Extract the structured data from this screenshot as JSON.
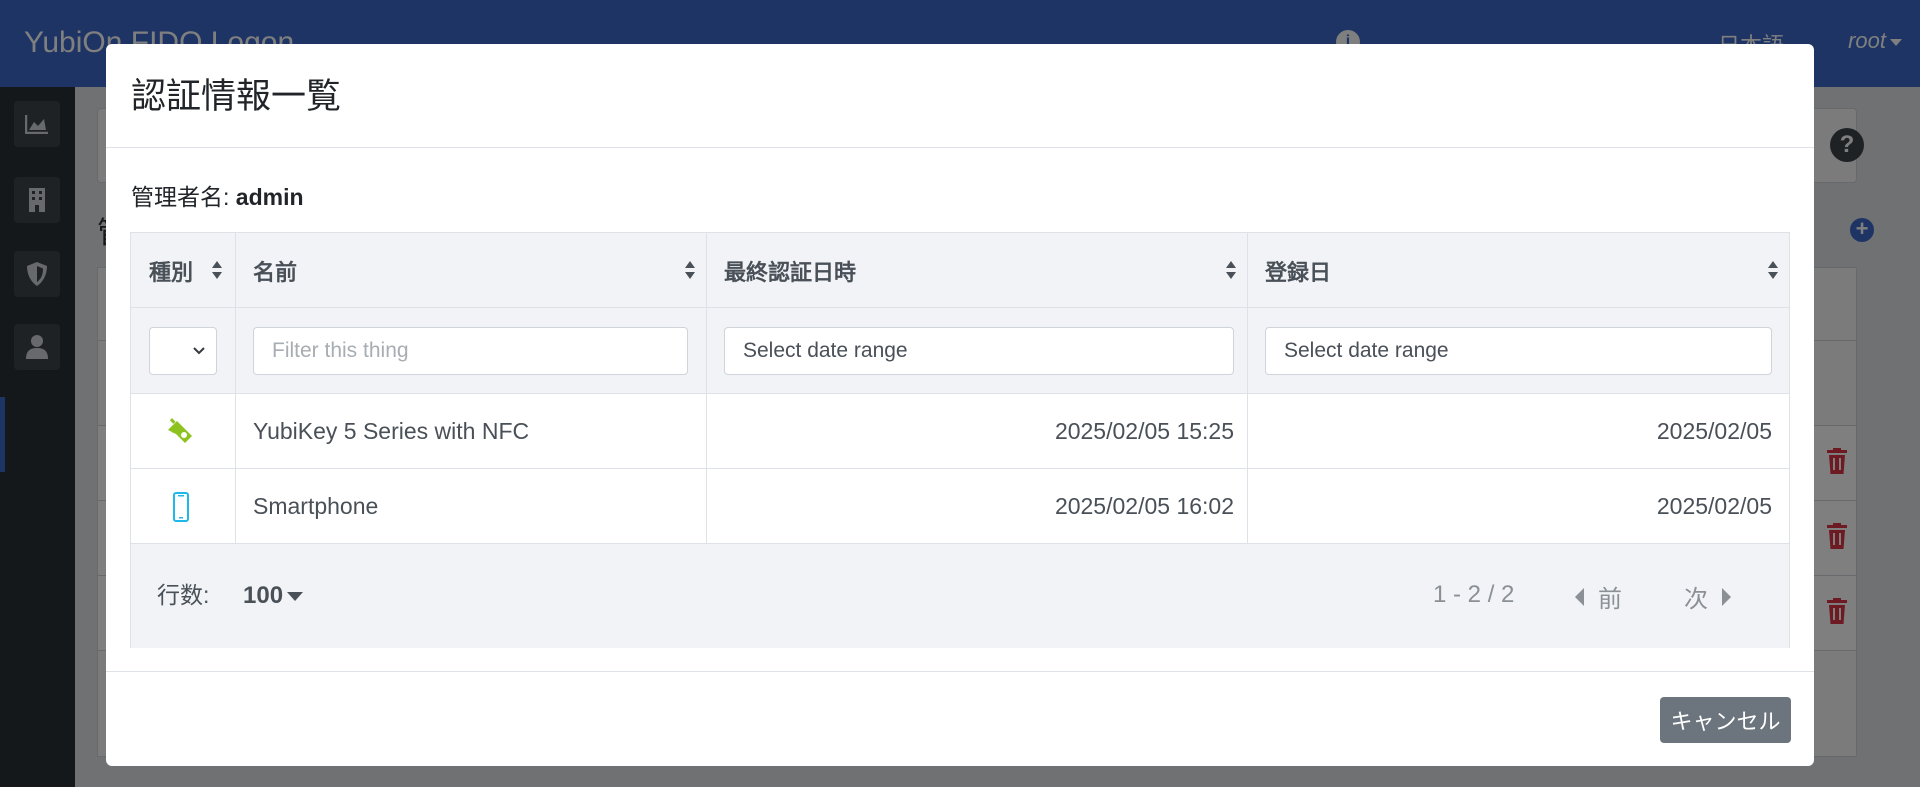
{
  "app": {
    "title": "YubiOn FIDO Logon"
  },
  "navbar": {
    "language": "日本語",
    "user": "root"
  },
  "background": {
    "heading": "管"
  },
  "modal": {
    "title": "認証情報一覧",
    "admin_label": "管理者名:",
    "admin_name": "admin",
    "columns": [
      {
        "label": "種別"
      },
      {
        "label": "名前"
      },
      {
        "label": "最終認証日時"
      },
      {
        "label": "登録日"
      }
    ],
    "filters": {
      "type_value": "",
      "name_placeholder": "Filter this thing",
      "last_auth_placeholder": "Select date range",
      "registered_placeholder": "Select date range"
    },
    "rows": [
      {
        "type_icon": "security-key-icon",
        "name": "YubiKey 5 Series with NFC",
        "last_auth": "2025/02/05 15:25",
        "registered": "2025/02/05"
      },
      {
        "type_icon": "smartphone-icon",
        "name": "Smartphone",
        "last_auth": "2025/02/05 16:02",
        "registered": "2025/02/05"
      }
    ],
    "footer": {
      "rows_label": "行数:",
      "rows_value": "100",
      "range": "1 - 2 / 2",
      "prev": "前",
      "next": "次"
    },
    "cancel_label": "キャンセル"
  },
  "colors": {
    "navbar": "#3a68c9",
    "key_icon": "#8dc21f",
    "phone_icon": "#1fb8e8",
    "trash": "#dc3545",
    "cancel_button": "#6c757d"
  }
}
